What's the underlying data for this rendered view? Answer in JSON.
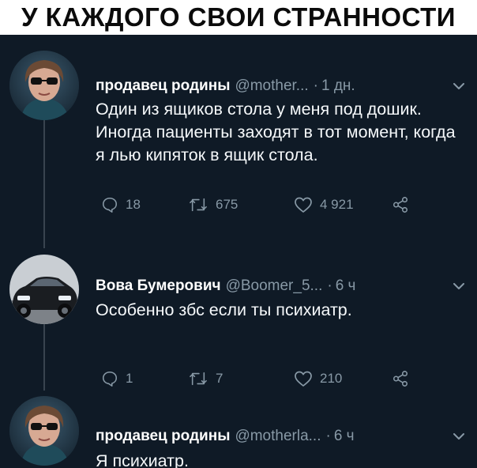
{
  "header": {
    "title": "У КАЖДОГО СВОИ СТРАННОСТИ"
  },
  "tweets": [
    {
      "author": "продавец родины",
      "handle": "@mother...",
      "time": "1 дн.",
      "text": "Один из ящиков стола у меня под дошик. Иногда пациенты заходят в тот момент, когда я лью кипяток в ящик стола.",
      "replies": "18",
      "retweets": "675",
      "likes": "4 921",
      "avatar": "avatar-person-sunglasses"
    },
    {
      "author": "Вова Бумерович",
      "handle": "@Boomer_5...",
      "time": "6 ч",
      "text": "Особенно збс если ты психиатр.",
      "replies": "1",
      "retweets": "7",
      "likes": "210",
      "avatar": "avatar-car-bmw"
    },
    {
      "author": "продавец родины",
      "handle": "@motherla...",
      "time": "6 ч",
      "text": "Я психиатр.",
      "avatar": "avatar-person-sunglasses"
    }
  ],
  "colors": {
    "background": "#0f1a26",
    "muted": "#8899a6",
    "text": "#f5f8fa",
    "thread_line": "#39444f"
  }
}
